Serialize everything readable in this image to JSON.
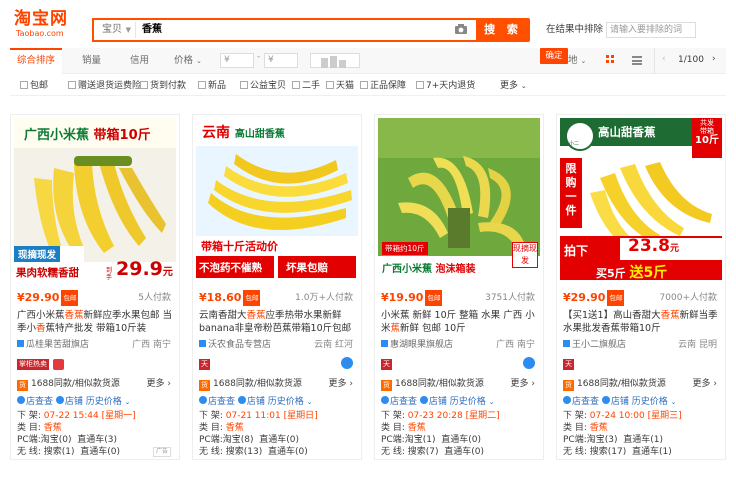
{
  "logo": {
    "cn": "淘宝网",
    "en": "Taobao.com"
  },
  "search": {
    "category": "宝贝",
    "query": "香蕉",
    "button": "搜 索",
    "exclude_label": "在结果中排除",
    "exclude_placeholder": "请输入要排除的词"
  },
  "sort": {
    "items": [
      "综合排序",
      "销量",
      "信用",
      "价格"
    ],
    "price_min": "¥",
    "price_max": "¥",
    "confirm": "确定",
    "location": "地",
    "page": "1/100"
  },
  "filters": [
    "包邮",
    "赠送退货运费险",
    "货到付款",
    "新品",
    "公益宝贝",
    "二手",
    "天猫",
    "正品保障",
    "7+天内退货",
    "更多"
  ],
  "colors": {
    "accent": "#ff4400",
    "link": "#2d6cc0"
  },
  "products": [
    {
      "img": {
        "line1": "广西小米蕉",
        "line2": "带箱10斤",
        "tag": "现摘现发",
        "bottom": "果肉软糯香甜",
        "tiny": "到手",
        "price": "29.9",
        "unit": "元"
      },
      "price": "¥29.90",
      "badge": "包邮",
      "sold": "5人付款",
      "title_pre": "广西小米蕉",
      "title_hl": "香蕉",
      "title_post": "新鲜应季水果包邮 当季小",
      "title_hl2": "香",
      "title_end": "蕉特产批发 带箱10斤装",
      "shop": "瓜桂果苦甜旗店",
      "loc": "广西 南宁",
      "tag": "掌柜热卖",
      "same": "1688同款/相似款货源",
      "more": "更多",
      "tools": [
        "店查查",
        "店铺",
        "历史价格"
      ],
      "listed": "下 架:",
      "date": "07-22 15:44",
      "weekday": "[星期一]",
      "cat_label": "类 目:",
      "cat": "香蕉",
      "pc": "PC端:",
      "pc_vals": [
        "淘宝(0)",
        "直通车(3)"
      ],
      "wx": "无 线:",
      "wx_vals": [
        "搜索(1)",
        "直通车(0)"
      ]
    },
    {
      "img": {
        "line1": "云南",
        "line2": "高山甜香蕉",
        "tag": "带箱十斤活动价",
        "bottom1": "不泡药不催熟",
        "bottom2": "坏果包赔"
      },
      "price": "¥18.60",
      "badge": "包邮",
      "sold": "1.0万+人付款",
      "title_pre": "云南香甜大",
      "title_hl": "香蕉",
      "title_post": "应季热带水果新鲜banana",
      "title_hl2": "",
      "title_end": "非皇帝粉芭蕉带箱10斤包邮",
      "shop": "沃农食品专营店",
      "loc": "云南 红河",
      "tag": "",
      "same": "1688同款/相似款货源",
      "more": "更多",
      "tools": [
        "店查查",
        "店铺",
        "历史价格"
      ],
      "listed": "下 架:",
      "date": "07-21 11:01",
      "weekday": "[星期日]",
      "cat_label": "类 目:",
      "cat": "香蕉",
      "pc": "PC端:",
      "pc_vals": [
        "淘宝(8)",
        "直通车(0)"
      ],
      "wx": "无 线:",
      "wx_vals": [
        "搜索(13)",
        "直通车(0)"
      ]
    },
    {
      "img": {
        "line1": "带箱约10斤",
        "line2": "广西小米蕉",
        "line3": "泡沫箱装",
        "tag": "现摘现发"
      },
      "price": "¥19.90",
      "badge": "包邮",
      "sold": "3751人付款",
      "title_pre": "小米蕉 新鲜 10斤 整箱 水果 广西 小米",
      "title_hl": "蕉",
      "title_post": "新鲜 包邮 10斤",
      "title_hl2": "",
      "title_end": "",
      "shop": "惠湖眼果旗舰店",
      "loc": "广西 南宁",
      "tag": "",
      "same": "1688同款/相似款货源",
      "more": "更多",
      "tools": [
        "店查查",
        "店铺",
        "历史价格"
      ],
      "listed": "下 架:",
      "date": "07-23 20:28",
      "weekday": "[星期二]",
      "cat_label": "类 目:",
      "cat": "香蕉",
      "pc": "PC端:",
      "pc_vals": [
        "淘宝(1)",
        "直通车(0)"
      ],
      "wx": "无 线:",
      "wx_vals": [
        "搜索(7)",
        "直通车(0)"
      ]
    },
    {
      "img": {
        "line1": "高山甜香蕉",
        "corner1": "共发",
        "corner2": "带箱",
        "corner3": "10斤",
        "side": "限购一件",
        "bottom1": "拍下",
        "price": "23.8",
        "unit": "元",
        "bottom2": "买5斤",
        "bottom3": "送5斤",
        "mascot": "王小二"
      },
      "price": "¥29.90",
      "badge": "包邮",
      "sold": "7000+人付款",
      "title_pre": "【买1送1】高山香甜大",
      "title_hl": "香蕉",
      "title_post": "新鲜当季水果批发香蕉带箱10斤",
      "title_hl2": "",
      "title_end": "",
      "shop": "王小二旗舰店",
      "loc": "云南 昆明",
      "tag": "",
      "same": "1688同款/相似款货源",
      "more": "更多",
      "tools": [
        "店查查",
        "店铺",
        "历史价格"
      ],
      "listed": "下 架:",
      "date": "07-24 10:00",
      "weekday": "[星期三]",
      "cat_label": "类 目:",
      "cat": "香蕉",
      "pc": "PC端:",
      "pc_vals": [
        "淘宝(3)",
        "直通车(1)"
      ],
      "wx": "无 线:",
      "wx_vals": [
        "搜索(17)",
        "直通车(1)"
      ]
    }
  ]
}
